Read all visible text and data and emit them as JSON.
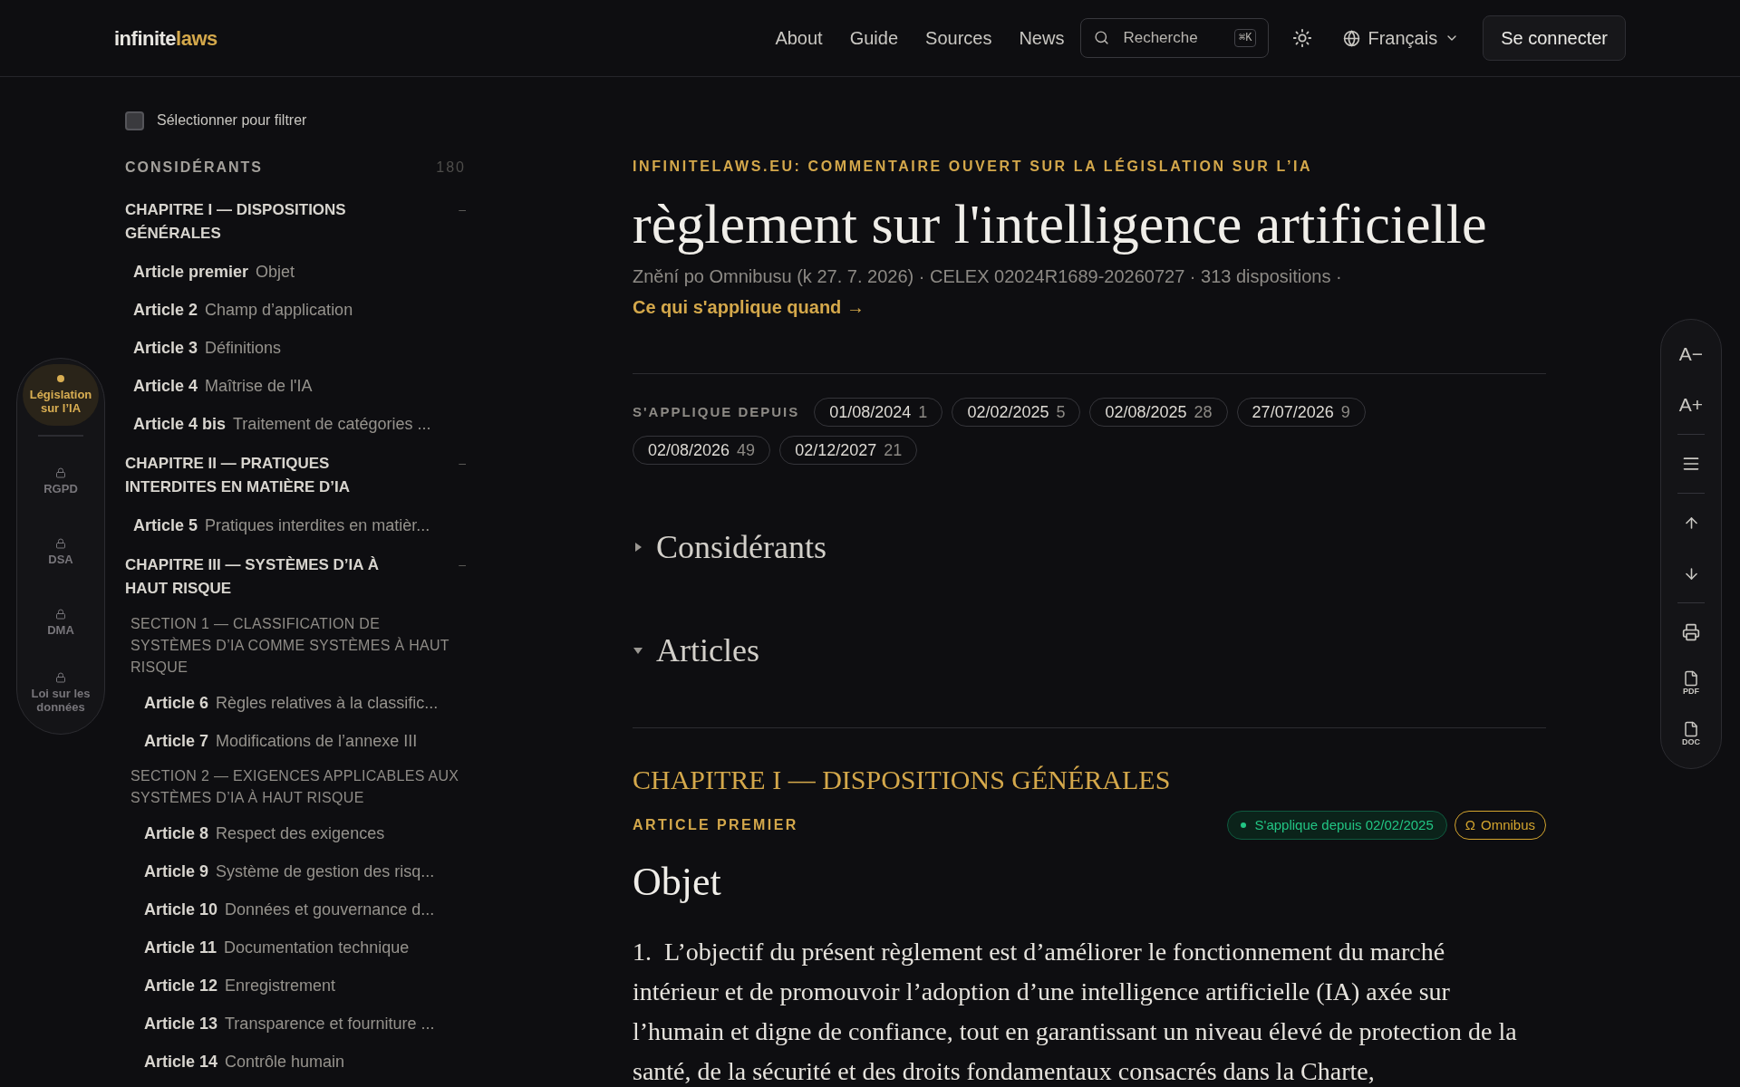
{
  "header": {
    "logo": {
      "first": "infinite",
      "second": "laws"
    },
    "nav": [
      "About",
      "Guide",
      "Sources",
      "News"
    ],
    "search": {
      "placeholder": "Recherche",
      "shortcut": "⌘K"
    },
    "language": "Français",
    "login": "Se connecter"
  },
  "left_rail": [
    {
      "label": "Législation sur l’IA",
      "selected": true,
      "locked": false
    },
    {
      "label": "RGPD",
      "selected": false,
      "locked": true
    },
    {
      "label": "DSA",
      "selected": false,
      "locked": true
    },
    {
      "label": "DMA",
      "selected": false,
      "locked": true
    },
    {
      "label": "Loi sur les données",
      "selected": false,
      "locked": true
    }
  ],
  "sidebar": {
    "filter": {
      "label": "Sélectionner pour filtrer",
      "checked": false
    },
    "recitals": {
      "label": "CONSIDÉRANTS",
      "count": "180"
    },
    "chapters": [
      {
        "title": "CHAPITRE I — DISPOSITIONS GÉNÉRALES",
        "toggle": "–",
        "expanded": true,
        "children": [
          {
            "kind": "article",
            "number": "Article premier",
            "title": "Objet"
          },
          {
            "kind": "article",
            "number": "Article 2",
            "title": "Champ d’application"
          },
          {
            "kind": "article",
            "number": "Article 3",
            "title": "Définitions"
          },
          {
            "kind": "article",
            "number": "Article 4",
            "title": "Maîtrise de l'IA"
          },
          {
            "kind": "article",
            "number": "Article 4 bis",
            "title": "Traitement de catégories ..."
          }
        ]
      },
      {
        "title": "CHAPITRE II — PRATIQUES INTERDITES EN MATIÈRE D’IA",
        "toggle": "–",
        "expanded": true,
        "children": [
          {
            "kind": "article",
            "number": "Article 5",
            "title": "Pratiques interdites en matièr..."
          }
        ]
      },
      {
        "title": "CHAPITRE III — SYSTÈMES D’IA À HAUT RISQUE",
        "toggle": "–",
        "expanded": true,
        "children": [
          {
            "kind": "section",
            "title": "SECTION 1 — CLASSIFICATION DE SYSTÈMES D’IA COMME SYSTÈMES À HAUT RISQUE",
            "children": [
              {
                "kind": "article",
                "number": "Article 6",
                "title": "Règles relatives à la classific..."
              },
              {
                "kind": "article",
                "number": "Article 7",
                "title": "Modifications de l’annexe III"
              }
            ]
          },
          {
            "kind": "section",
            "title": "SECTION 2 — EXIGENCES APPLICABLES AUX SYSTÈMES D’IA À HAUT RISQUE",
            "children": [
              {
                "kind": "article",
                "number": "Article 8",
                "title": "Respect des exigences"
              },
              {
                "kind": "article",
                "number": "Article 9",
                "title": "Système de gestion des risq..."
              },
              {
                "kind": "article",
                "number": "Article 10",
                "title": "Données et gouvernance d..."
              },
              {
                "kind": "article",
                "number": "Article 11",
                "title": "Documentation technique"
              },
              {
                "kind": "article",
                "number": "Article 12",
                "title": "Enregistrement"
              },
              {
                "kind": "article",
                "number": "Article 13",
                "title": "Transparence et fourniture ..."
              },
              {
                "kind": "article",
                "number": "Article 14",
                "title": "Contrôle humain"
              }
            ]
          }
        ]
      }
    ]
  },
  "main": {
    "eyebrow": "INFINITELAWS.EU: COMMENTAIRE OUVERT SUR LA LÉGISLATION SUR L’IA",
    "title": "règlement sur l'intelligence artificielle",
    "meta": "Znění po Omnibusu (k 27. 7. 2026) · CELEX 02024R1689-20260727 · 313 dispositions ·",
    "meta_link": "Ce qui s'applique quand →",
    "applies": {
      "label": "S'APPLIQUE DEPUIS",
      "dates": [
        {
          "date": "01/08/2024",
          "count": "1"
        },
        {
          "date": "02/02/2025",
          "count": "5"
        },
        {
          "date": "02/08/2025",
          "count": "28"
        },
        {
          "date": "27/07/2026",
          "count": "9"
        },
        {
          "date": "02/08/2026",
          "count": "49"
        },
        {
          "date": "02/12/2027",
          "count": "21"
        }
      ]
    },
    "sections": [
      {
        "label": "Considérants",
        "expanded": false
      },
      {
        "label": "Articles",
        "expanded": true
      }
    ],
    "chapter": "CHAPITRE I — DISPOSITIONS GÉNÉRALES",
    "article_label": "ARTICLE PREMIER",
    "badges": [
      {
        "kind": "status",
        "text": "S'applique depuis 02/02/2025",
        "color": "#22c584"
      },
      {
        "kind": "amendment",
        "symbol": "Ω",
        "text": "Omnibus",
        "color": "#d4a52e"
      }
    ],
    "article_title": "Objet",
    "paragraphs": [
      {
        "number": "1.",
        "text": "L’objectif du présent règlement est d’améliorer le fonctionnement du marché intérieur et de promouvoir l’adoption d’une intelligence artificielle (IA) axée sur l’humain et digne de confiance, tout en garantissant un niveau élevé de protection de la santé, de la sécurité et des droits fondamentaux consacrés dans la Charte,"
      }
    ]
  },
  "right_tools": [
    {
      "kind": "text",
      "label": "A−"
    },
    {
      "kind": "text",
      "label": "A+"
    },
    {
      "kind": "divider"
    },
    {
      "kind": "lines"
    },
    {
      "kind": "divider"
    },
    {
      "kind": "up"
    },
    {
      "kind": "down"
    },
    {
      "kind": "divider"
    },
    {
      "kind": "print"
    },
    {
      "kind": "file",
      "label": "PDF"
    },
    {
      "kind": "file",
      "label": "DOC"
    }
  ]
}
